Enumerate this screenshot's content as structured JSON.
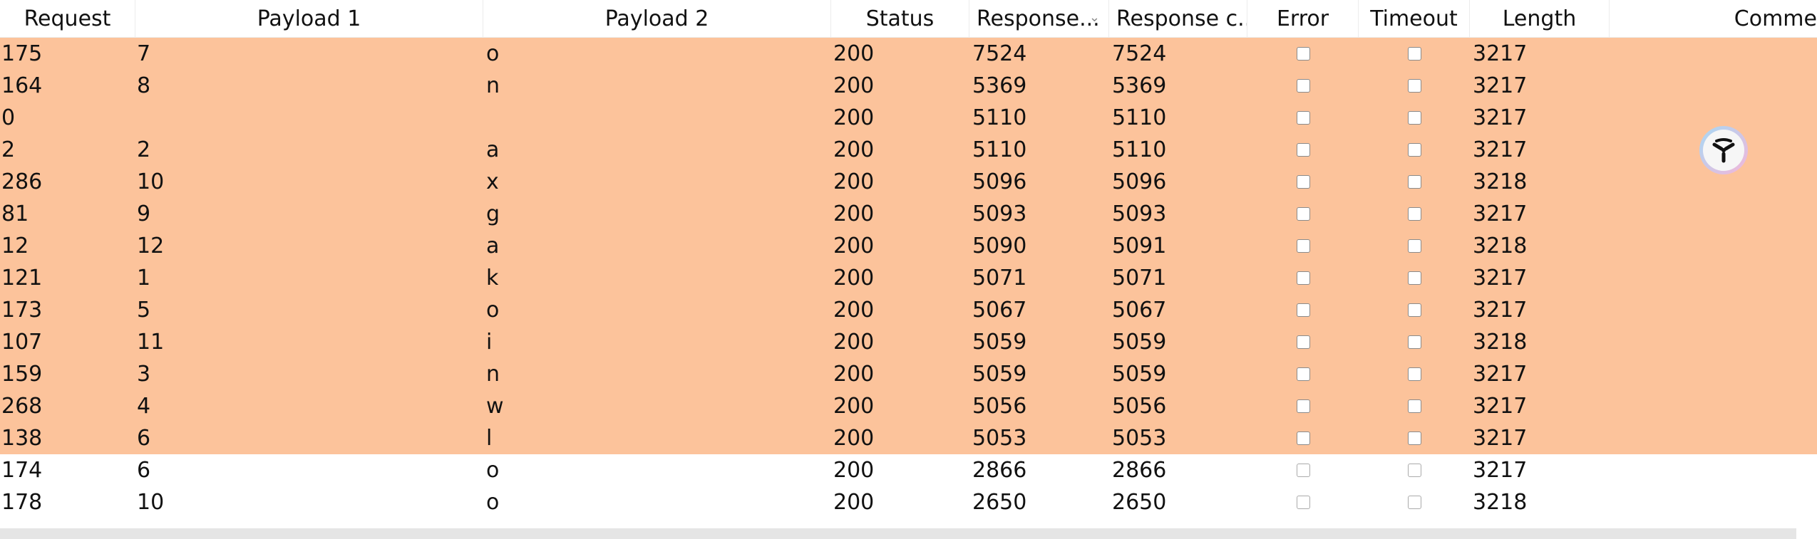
{
  "columns": {
    "request": "Request",
    "payload1": "Payload 1",
    "payload2": "Payload 2",
    "status": "Status",
    "response_received": "Response...",
    "response_completed": "Response c...",
    "error": "Error",
    "timeout": "Timeout",
    "length": "Length",
    "comment": "Comme"
  },
  "sorted_column": "response_received",
  "colors": {
    "highlight": "#fcc39b",
    "header_bg": "#ffffff"
  },
  "rows": [
    {
      "request": "175",
      "payload1": "7",
      "payload2": "o",
      "status": "200",
      "rt1": "7524",
      "rt2": "7524",
      "length": "3217",
      "error": false,
      "timeout": false,
      "highlight": true
    },
    {
      "request": "164",
      "payload1": "8",
      "payload2": "n",
      "status": "200",
      "rt1": "5369",
      "rt2": "5369",
      "length": "3217",
      "error": false,
      "timeout": false,
      "highlight": true
    },
    {
      "request": "0",
      "payload1": "",
      "payload2": "",
      "status": "200",
      "rt1": "5110",
      "rt2": "5110",
      "length": "3217",
      "error": false,
      "timeout": false,
      "highlight": true
    },
    {
      "request": "2",
      "payload1": "2",
      "payload2": "a",
      "status": "200",
      "rt1": "5110",
      "rt2": "5110",
      "length": "3217",
      "error": false,
      "timeout": false,
      "highlight": true
    },
    {
      "request": "286",
      "payload1": "10",
      "payload2": "x",
      "status": "200",
      "rt1": "5096",
      "rt2": "5096",
      "length": "3218",
      "error": false,
      "timeout": false,
      "highlight": true
    },
    {
      "request": "81",
      "payload1": "9",
      "payload2": "g",
      "status": "200",
      "rt1": "5093",
      "rt2": "5093",
      "length": "3217",
      "error": false,
      "timeout": false,
      "highlight": true
    },
    {
      "request": "12",
      "payload1": "12",
      "payload2": "a",
      "status": "200",
      "rt1": "5090",
      "rt2": "5091",
      "length": "3218",
      "error": false,
      "timeout": false,
      "highlight": true
    },
    {
      "request": "121",
      "payload1": "1",
      "payload2": "k",
      "status": "200",
      "rt1": "5071",
      "rt2": "5071",
      "length": "3217",
      "error": false,
      "timeout": false,
      "highlight": true
    },
    {
      "request": "173",
      "payload1": "5",
      "payload2": "o",
      "status": "200",
      "rt1": "5067",
      "rt2": "5067",
      "length": "3217",
      "error": false,
      "timeout": false,
      "highlight": true
    },
    {
      "request": "107",
      "payload1": "11",
      "payload2": "i",
      "status": "200",
      "rt1": "5059",
      "rt2": "5059",
      "length": "3218",
      "error": false,
      "timeout": false,
      "highlight": true
    },
    {
      "request": "159",
      "payload1": "3",
      "payload2": "n",
      "status": "200",
      "rt1": "5059",
      "rt2": "5059",
      "length": "3217",
      "error": false,
      "timeout": false,
      "highlight": true
    },
    {
      "request": "268",
      "payload1": "4",
      "payload2": "w",
      "status": "200",
      "rt1": "5056",
      "rt2": "5056",
      "length": "3217",
      "error": false,
      "timeout": false,
      "highlight": true
    },
    {
      "request": "138",
      "payload1": "6",
      "payload2": "l",
      "status": "200",
      "rt1": "5053",
      "rt2": "5053",
      "length": "3217",
      "error": false,
      "timeout": false,
      "highlight": true
    },
    {
      "request": "174",
      "payload1": "6",
      "payload2": "o",
      "status": "200",
      "rt1": "2866",
      "rt2": "2866",
      "length": "3217",
      "error": false,
      "timeout": false,
      "highlight": false
    },
    {
      "request": "178",
      "payload1": "10",
      "payload2": "o",
      "status": "200",
      "rt1": "2650",
      "rt2": "2650",
      "length": "3218",
      "error": false,
      "timeout": false,
      "highlight": false
    }
  ],
  "floating_button": {
    "icon": "assistant-logo-icon"
  }
}
